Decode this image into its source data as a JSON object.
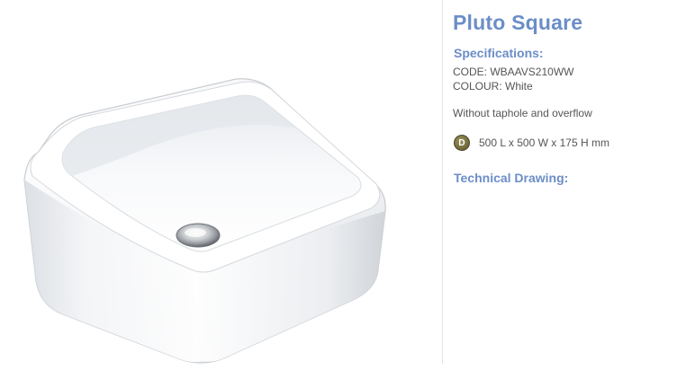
{
  "product": {
    "name": "Pluto Square",
    "image_alt": "white square ceramic vessel basin"
  },
  "specifications": {
    "heading": "Specifications:",
    "code": "CODE: WBAAVS210WW",
    "colour": "COLOUR: White",
    "note": "Without taphole and overflow",
    "dimension_badge": "D",
    "dimensions": "500 L x 500 W x 175 H mm"
  },
  "technical": {
    "heading": "Technical Drawing:"
  },
  "colors": {
    "heading_blue": "#6b8ec7",
    "text_gray": "#555555",
    "badge_olive": "#6e6838"
  }
}
